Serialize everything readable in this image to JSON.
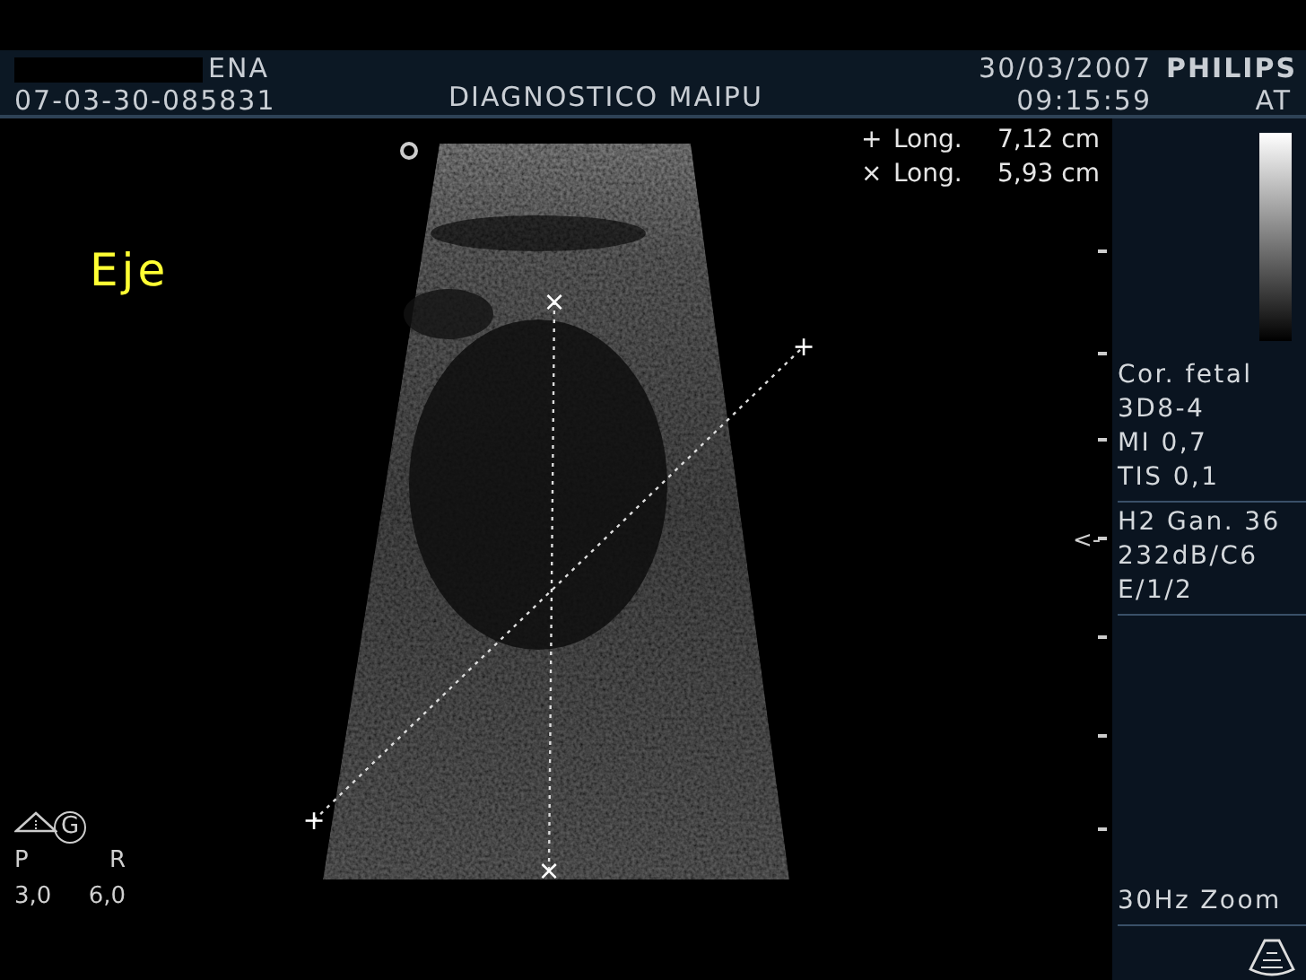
{
  "header": {
    "patient_name": "ENA",
    "exam_id": "07-03-30-085831",
    "institution": "DIAGNOSTICO MAIPU",
    "date": "30/03/2007",
    "time": "09:15:59",
    "brand": "PHILIPS",
    "mode": "AT"
  },
  "annotation": {
    "text": "Eje"
  },
  "measurements": [
    {
      "marker": "+",
      "label": "Long.",
      "value": "7,12 cm",
      "ends": [
        "+",
        "+"
      ]
    },
    {
      "marker": "×",
      "label": "Long.",
      "value": "5,93 cm",
      "ends": [
        "×",
        "×"
      ]
    }
  ],
  "orientation": {
    "badge": "G",
    "left": "P",
    "right": "R",
    "values": [
      "3,0",
      "6,0"
    ]
  },
  "depth_pointer": "<-",
  "side_panel": {
    "groups": [
      [
        "Cor. fetal",
        "3D8-4",
        "MI 0,7",
        "TIS 0,1"
      ],
      [
        "H2 Gan. 36",
        "232dB/C6",
        "E/1/2"
      ],
      [
        "30Hz Zoom"
      ]
    ]
  }
}
